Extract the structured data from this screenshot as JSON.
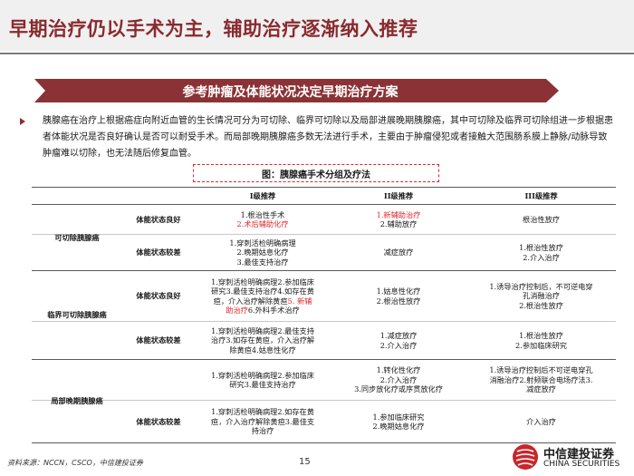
{
  "header": {
    "title": "早期治疗仍以手术为主，辅助治疗逐渐纳入推荐"
  },
  "banner": {
    "text": "参考肿瘤及体能状况决定早期治疗方案"
  },
  "intro": {
    "text": "胰腺癌在治疗上根据癌症向附近血管的生长情况可分为可切除、临界可切除以及局部进展晚期胰腺癌，其中可切除及临界可切除组进一步根据患者体能状况是否良好确认是否可以耐受手术。而局部晚期胰腺癌多数无法进行手术，主要由于肿瘤侵犯或者接触大范围肠系膜上静脉/动脉导致肿瘤难以切除，也无法随后修复血管。"
  },
  "figure": {
    "caption": "图：胰腺癌手术分组及疗法"
  },
  "table": {
    "headers": [
      "I级推荐",
      "II级推荐",
      "III级推荐"
    ],
    "groups": [
      {
        "name": "可切除胰腺癌",
        "rows": [
          {
            "condition": "体能状态良好",
            "c1": [
              {
                "text": "1.根治性手术",
                "red": false
              },
              {
                "text": "2.术后辅助化疗",
                "red": true
              }
            ],
            "c2": [
              {
                "text": "1.新辅助治疗",
                "red": true
              },
              {
                "text": "2.辅助放疗",
                "red": false
              }
            ],
            "c3": [
              {
                "text": "根治性放疗",
                "red": false
              }
            ]
          },
          {
            "condition": "体能状态较差",
            "c1": [
              {
                "text": "1.穿刺活检明确病理",
                "red": false
              },
              {
                "text": "2.晚期姑息化疗",
                "red": false
              },
              {
                "text": "3.最佳支持治疗",
                "red": false
              }
            ],
            "c2": [
              {
                "text": "减症放疗",
                "red": false
              }
            ],
            "c3": [
              {
                "text": "1.根治性放疗",
                "red": false
              },
              {
                "text": "2.介入治疗",
                "red": false
              }
            ]
          }
        ]
      },
      {
        "name": "临界可切除胰腺癌",
        "rows": [
          {
            "condition": "体能状态良好",
            "c1_lines": [
              [
                {
                  "text": "1.穿刺活检明确病理2.参加临床",
                  "red": false
                }
              ],
              [
                {
                  "text": "研究3.最佳支持治疗4.如存在黄",
                  "red": false
                }
              ],
              [
                {
                  "text": "疸，介入治疗解除黄疸",
                  "red": false
                },
                {
                  "text": "5. 新辅",
                  "red": true
                }
              ],
              [
                {
                  "text": "助治疗",
                  "red": true
                },
                {
                  "text": "6.外科手术治疗",
                  "red": false
                }
              ]
            ],
            "c2": [
              {
                "text": "1.姑息性化疗",
                "red": false
              },
              {
                "text": "2.根治性放疗",
                "red": false
              }
            ],
            "c3": [
              {
                "text": "1.诱导治疗控制后，不可逆电穿",
                "red": false
              },
              {
                "text": "孔消融治疗",
                "red": false
              },
              {
                "text": "2.根治性放疗",
                "red": false
              }
            ]
          },
          {
            "condition": "体能状态较差",
            "c1": [
              {
                "text": "1.穿刺活检明确病理2.最佳支持",
                "red": false
              },
              {
                "text": "治疗3.如存在黄疸，介入治疗解",
                "red": false
              },
              {
                "text": "除黄疸4.姑息性化疗",
                "red": false
              }
            ],
            "c2": [
              {
                "text": "1.减症放疗",
                "red": false
              },
              {
                "text": "2.介入治疗",
                "red": false
              }
            ],
            "c3": [
              {
                "text": "1.根治性放疗",
                "red": false
              },
              {
                "text": "2.参加临床研究",
                "red": false
              }
            ]
          }
        ]
      },
      {
        "name": "局部晚期胰腺癌",
        "rows": [
          {
            "condition": "",
            "c1": [
              {
                "text": "1.穿刺活检明确病理2.参加临床",
                "red": false
              },
              {
                "text": "研究3.最佳支持治疗",
                "red": false
              }
            ],
            "c2": [
              {
                "text": "1.转化性化疗",
                "red": false
              },
              {
                "text": "2.介入治疗",
                "red": false
              },
              {
                "text": "3.同步放化疗或序贯放化疗",
                "red": false
              }
            ],
            "c3": [
              {
                "text": "1.诱导治疗控制后不可逆电穿孔",
                "red": false
              },
              {
                "text": "消融治疗2.射频联合电场疗法3.",
                "red": false
              },
              {
                "text": "减症放疗",
                "red": false
              }
            ]
          },
          {
            "condition": "体能状态较差",
            "c1": [
              {
                "text": "1.穿刺活检明确病理2.如存在黄",
                "red": false
              },
              {
                "text": "疸，介入治疗解除黄疸3.最佳支",
                "red": false
              },
              {
                "text": "持治疗",
                "red": false
              }
            ],
            "c2": [
              {
                "text": "1.参加临床研究",
                "red": false
              },
              {
                "text": "2.晚期姑息化疗",
                "red": false
              }
            ],
            "c3": [
              {
                "text": "介入治疗",
                "red": false
              }
            ]
          }
        ]
      }
    ]
  },
  "footer": {
    "source": "资料来源：NCCN，CSCO，中信建投证券",
    "page": "15",
    "logo_cn": "中信建投证券",
    "logo_en": "CHINA SECURITIES"
  },
  "colors": {
    "title": "#8a2a2e",
    "banner": "#8b3236",
    "highlight": "#e0262b",
    "caption_border": "#d9262d"
  }
}
